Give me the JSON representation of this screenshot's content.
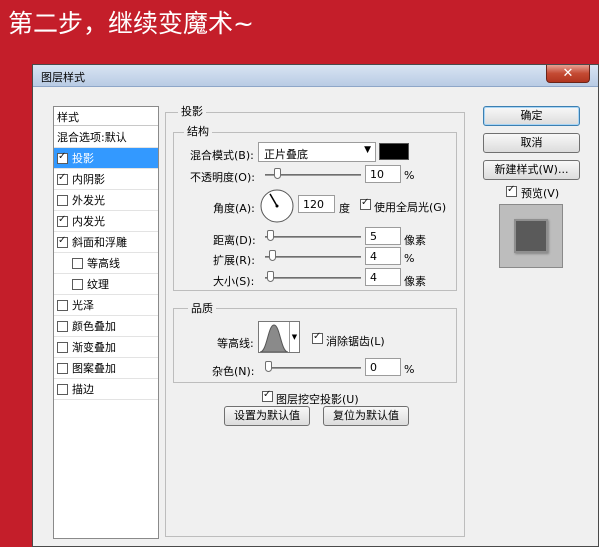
{
  "banner": "第二步，继续变魔术~",
  "window": {
    "title": "图层样式"
  },
  "styles_panel": {
    "header": "样式",
    "items": [
      {
        "label": "混合选项:默认",
        "checkbox": false,
        "checked": false,
        "selected": false,
        "indent": false
      },
      {
        "label": "投影",
        "checkbox": true,
        "checked": true,
        "selected": true,
        "indent": false
      },
      {
        "label": "内阴影",
        "checkbox": true,
        "checked": true,
        "selected": false,
        "indent": false
      },
      {
        "label": "外发光",
        "checkbox": true,
        "checked": false,
        "selected": false,
        "indent": false
      },
      {
        "label": "内发光",
        "checkbox": true,
        "checked": true,
        "selected": false,
        "indent": false
      },
      {
        "label": "斜面和浮雕",
        "checkbox": true,
        "checked": true,
        "selected": false,
        "indent": false
      },
      {
        "label": "等高线",
        "checkbox": true,
        "checked": false,
        "selected": false,
        "indent": true
      },
      {
        "label": "纹理",
        "checkbox": true,
        "checked": false,
        "selected": false,
        "indent": true
      },
      {
        "label": "光泽",
        "checkbox": true,
        "checked": false,
        "selected": false,
        "indent": false
      },
      {
        "label": "颜色叠加",
        "checkbox": true,
        "checked": false,
        "selected": false,
        "indent": false
      },
      {
        "label": "渐变叠加",
        "checkbox": true,
        "checked": false,
        "selected": false,
        "indent": false
      },
      {
        "label": "图案叠加",
        "checkbox": true,
        "checked": false,
        "selected": false,
        "indent": false
      },
      {
        "label": "描边",
        "checkbox": true,
        "checked": false,
        "selected": false,
        "indent": false
      }
    ]
  },
  "drop_shadow": {
    "title": "投影",
    "structure": {
      "title": "结构",
      "blend_mode": {
        "label": "混合模式(B):",
        "value": "正片叠底",
        "color": "#000000"
      },
      "opacity": {
        "label": "不透明度(O):",
        "value": "10",
        "unit": "%",
        "fraction": 0.1
      },
      "angle": {
        "label": "角度(A):",
        "value": "120",
        "unit": "度",
        "degrees": 120
      },
      "global_light": {
        "label": "使用全局光(G)",
        "checked": true
      },
      "distance": {
        "label": "距离(D):",
        "value": "5",
        "unit": "像素",
        "fraction": 0.02
      },
      "spread": {
        "label": "扩展(R):",
        "value": "4",
        "unit": "%",
        "fraction": 0.04
      },
      "size": {
        "label": "大小(S):",
        "value": "4",
        "unit": "像素",
        "fraction": 0.02
      }
    },
    "quality": {
      "title": "品质",
      "contour": {
        "label": "等高线:"
      },
      "anti_alias": {
        "label": "消除锯齿(L)",
        "checked": true
      },
      "noise": {
        "label": "杂色(N):",
        "value": "0",
        "unit": "%",
        "fraction": 0
      }
    },
    "knockout": {
      "label": "图层挖空投影(U)",
      "checked": true
    },
    "make_default": "设置为默认值",
    "reset_default": "复位为默认值"
  },
  "buttons": {
    "ok": "确定",
    "cancel": "取消",
    "new_style": "新建样式(W)..."
  },
  "preview": {
    "label": "预览(V)",
    "checked": true
  },
  "icons": {
    "close": "close-icon",
    "dropdown": "chevron-down-icon",
    "angle_dial": "angle-dial-icon",
    "contour": "contour-curve-icon"
  }
}
